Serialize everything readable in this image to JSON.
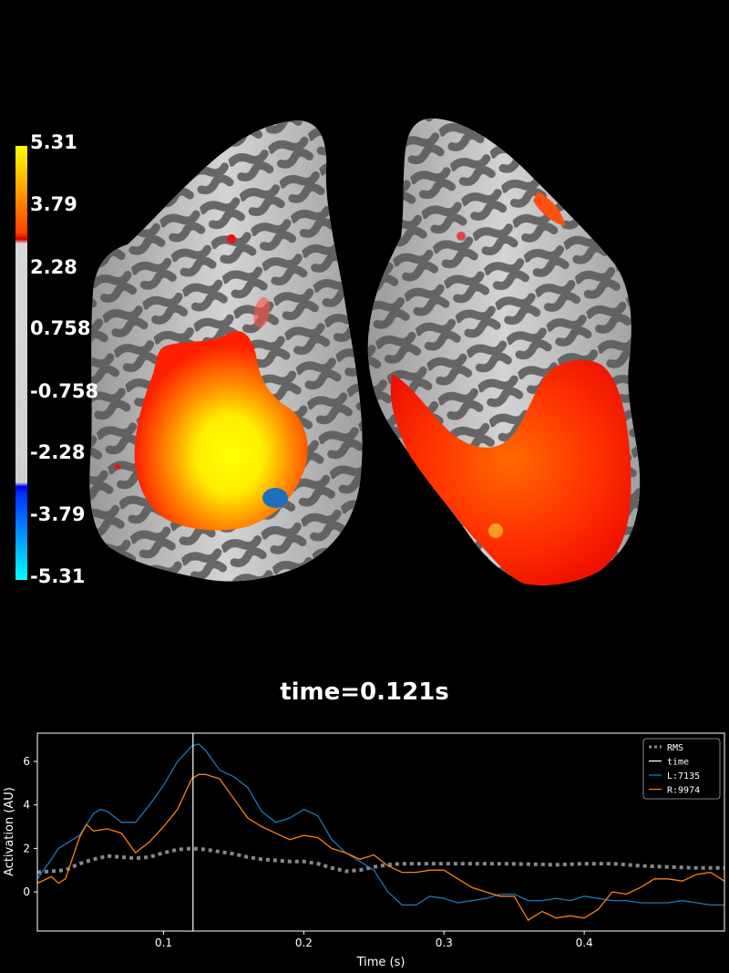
{
  "colorbar": {
    "ticks": [
      "5.31",
      "3.79",
      "2.28",
      "0.758",
      "-0.758",
      "-2.28",
      "-3.79",
      "-5.31"
    ],
    "colors": {
      "top": "#ffff00",
      "mid_pos": "#ff0000",
      "neutral": "#d0d0d0",
      "mid_neg": "#0000ff",
      "bottom": "#00ffff"
    }
  },
  "time_title": "time=0.121s",
  "chart_data": {
    "type": "line",
    "xlabel": "Time (s)",
    "ylabel": "Activation (AU)",
    "xlim": [
      0.01,
      0.5
    ],
    "ylim": [
      -1.8,
      7.3
    ],
    "xticks": [
      0.1,
      0.2,
      0.3,
      0.4
    ],
    "xtick_labels": [
      "0.1",
      "0.2",
      "0.3",
      "0.4"
    ],
    "yticks": [
      0,
      2,
      4,
      6
    ],
    "ytick_labels": [
      "0",
      "2",
      "4",
      "6"
    ],
    "legend_position": "top-right",
    "time_marker": 0.121,
    "series": [
      {
        "name": "RMS",
        "color": "#888888",
        "style": "dotted",
        "x": [
          0.01,
          0.02,
          0.03,
          0.04,
          0.05,
          0.06,
          0.07,
          0.08,
          0.09,
          0.1,
          0.11,
          0.12,
          0.13,
          0.14,
          0.15,
          0.16,
          0.17,
          0.18,
          0.19,
          0.2,
          0.21,
          0.22,
          0.23,
          0.24,
          0.25,
          0.26,
          0.27,
          0.28,
          0.3,
          0.32,
          0.34,
          0.36,
          0.38,
          0.4,
          0.42,
          0.44,
          0.46,
          0.48,
          0.5
        ],
        "y": [
          0.9,
          0.95,
          1.0,
          1.3,
          1.5,
          1.65,
          1.6,
          1.55,
          1.6,
          1.8,
          1.95,
          2.0,
          1.95,
          1.85,
          1.75,
          1.6,
          1.5,
          1.45,
          1.4,
          1.4,
          1.3,
          1.1,
          0.95,
          1.0,
          1.15,
          1.25,
          1.3,
          1.3,
          1.3,
          1.3,
          1.3,
          1.28,
          1.25,
          1.3,
          1.3,
          1.2,
          1.15,
          1.1,
          1.1
        ]
      },
      {
        "name": "L:7135",
        "color": "#1f77b4",
        "style": "solid",
        "x": [
          0.01,
          0.02,
          0.025,
          0.03,
          0.04,
          0.05,
          0.055,
          0.06,
          0.07,
          0.08,
          0.09,
          0.1,
          0.11,
          0.12,
          0.125,
          0.13,
          0.14,
          0.15,
          0.16,
          0.17,
          0.18,
          0.19,
          0.2,
          0.21,
          0.22,
          0.23,
          0.24,
          0.25,
          0.26,
          0.27,
          0.28,
          0.29,
          0.3,
          0.31,
          0.32,
          0.33,
          0.34,
          0.35,
          0.36,
          0.37,
          0.38,
          0.39,
          0.4,
          0.41,
          0.42,
          0.43,
          0.44,
          0.45,
          0.46,
          0.47,
          0.48,
          0.49,
          0.5
        ],
        "y": [
          0.6,
          1.5,
          2.0,
          2.2,
          2.6,
          3.6,
          3.8,
          3.7,
          3.2,
          3.2,
          4.0,
          4.9,
          6.0,
          6.7,
          6.8,
          6.5,
          5.6,
          5.3,
          4.8,
          3.7,
          3.2,
          3.4,
          3.8,
          3.5,
          2.4,
          1.8,
          1.4,
          1.0,
          0.0,
          -0.6,
          -0.6,
          -0.2,
          -0.3,
          -0.5,
          -0.4,
          -0.3,
          -0.1,
          -0.1,
          -0.4,
          -0.4,
          -0.3,
          -0.4,
          -0.2,
          -0.3,
          -0.4,
          -0.4,
          -0.5,
          -0.5,
          -0.5,
          -0.4,
          -0.5,
          -0.6,
          -0.6
        ]
      },
      {
        "name": "R:9974",
        "color": "#ff7f0e",
        "style": "solid",
        "x": [
          0.01,
          0.02,
          0.025,
          0.03,
          0.04,
          0.045,
          0.05,
          0.06,
          0.07,
          0.08,
          0.09,
          0.1,
          0.11,
          0.12,
          0.125,
          0.13,
          0.14,
          0.15,
          0.16,
          0.17,
          0.18,
          0.19,
          0.2,
          0.21,
          0.22,
          0.23,
          0.24,
          0.25,
          0.26,
          0.27,
          0.28,
          0.29,
          0.3,
          0.31,
          0.32,
          0.33,
          0.34,
          0.35,
          0.36,
          0.37,
          0.38,
          0.39,
          0.4,
          0.41,
          0.42,
          0.43,
          0.44,
          0.45,
          0.46,
          0.47,
          0.48,
          0.49,
          0.5
        ],
        "y": [
          0.4,
          0.7,
          0.4,
          0.6,
          2.5,
          3.1,
          2.8,
          2.9,
          2.7,
          1.8,
          2.3,
          3.0,
          3.8,
          5.2,
          5.4,
          5.4,
          5.2,
          4.3,
          3.4,
          3.0,
          2.7,
          2.4,
          2.6,
          2.5,
          2.0,
          1.8,
          1.5,
          1.7,
          1.2,
          0.9,
          0.9,
          1.0,
          1.0,
          0.6,
          0.2,
          0.0,
          -0.2,
          -0.2,
          -1.3,
          -0.9,
          -1.2,
          -1.1,
          -1.2,
          -0.8,
          0.0,
          -0.1,
          0.2,
          0.6,
          0.6,
          0.5,
          0.8,
          0.9,
          0.5
        ]
      }
    ]
  }
}
